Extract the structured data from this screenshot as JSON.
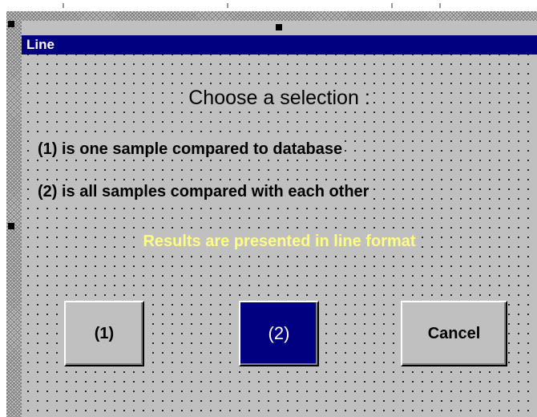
{
  "window": {
    "title": "Line"
  },
  "dialog": {
    "heading": "Choose a selection :",
    "option_1_text": "(1) is one sample compared to database",
    "option_2_text": "(2) is all samples compared with each other",
    "info_text": "Results are presented in line format"
  },
  "buttons": {
    "option_1_label": "(1)",
    "option_2_label": "(2)",
    "cancel_label": "Cancel"
  },
  "colors": {
    "title_bar": "#000080",
    "info_text": "#ffff80",
    "selected_button": "#000080",
    "form_background": "#c0c0c0"
  }
}
